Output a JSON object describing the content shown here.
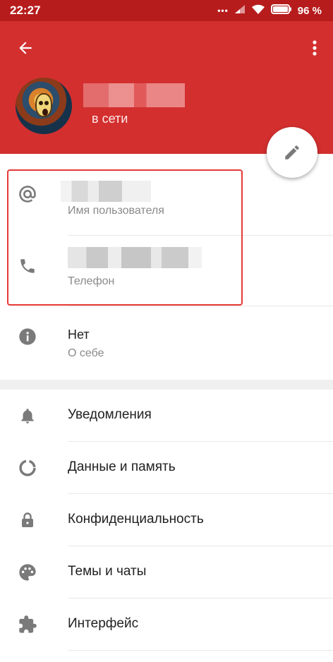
{
  "status_bar": {
    "time": "22:27",
    "dots": "•••",
    "battery": "96 %"
  },
  "header": {
    "status": "в сети",
    "colors": {
      "bar": "#d32f2f",
      "status_bar": "#b71c1c"
    }
  },
  "info": {
    "username_label": "Имя пользователя",
    "phone_label": "Телефон",
    "bio_value": "Нет",
    "bio_label": "О себе"
  },
  "settings": [
    {
      "label": "Уведомления",
      "icon": "bell-icon"
    },
    {
      "label": "Данные и память",
      "icon": "data-usage-icon"
    },
    {
      "label": "Конфиденциальность",
      "icon": "lock-icon"
    },
    {
      "label": "Темы и чаты",
      "icon": "palette-icon"
    },
    {
      "label": "Интерфейс",
      "icon": "puzzle-icon"
    }
  ],
  "accent": {
    "highlight_border": "#e53935",
    "icon_gray": "#7a7a7a"
  }
}
